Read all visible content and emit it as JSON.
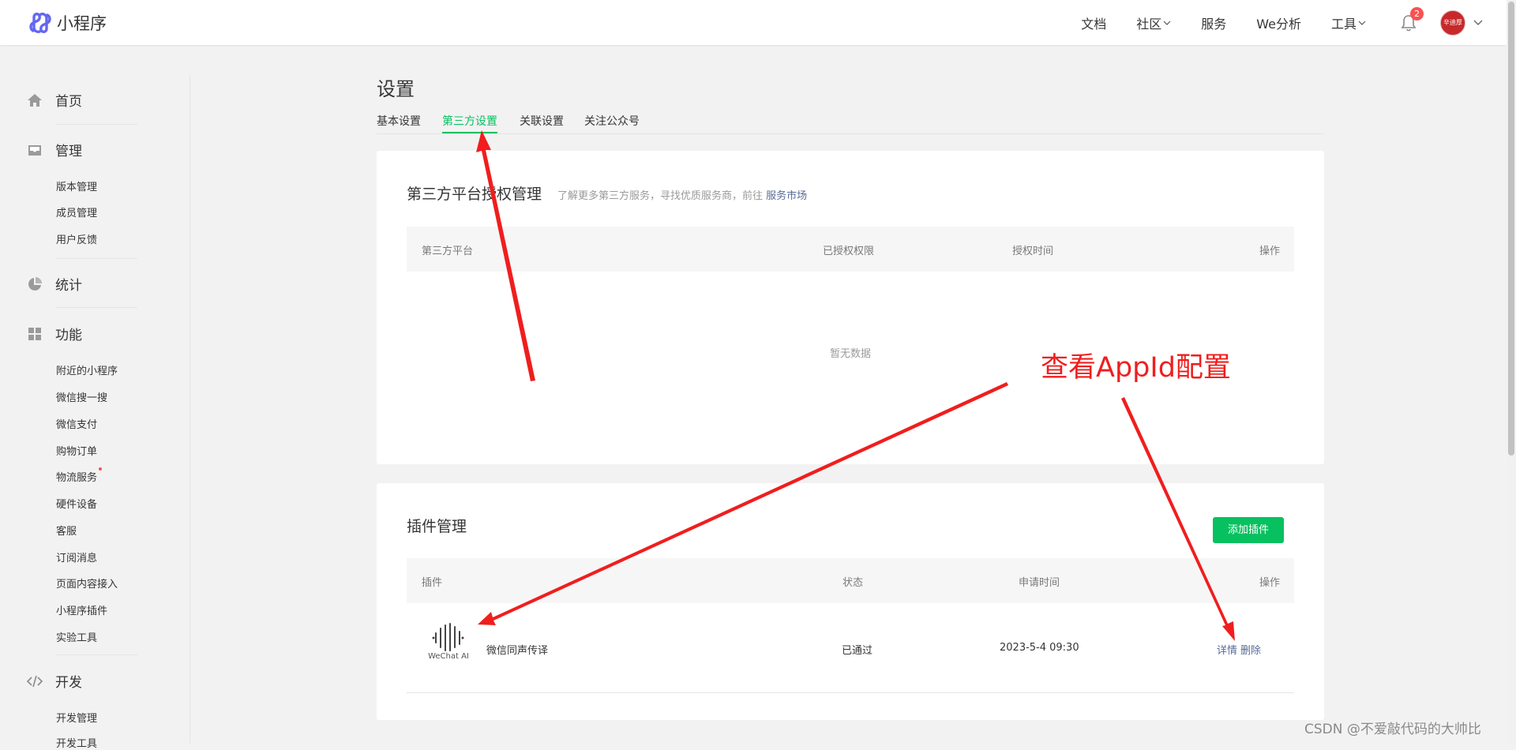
{
  "app": {
    "name": "小程序"
  },
  "topnav": {
    "items": [
      {
        "label": "文档",
        "has_dropdown": false
      },
      {
        "label": "社区",
        "has_dropdown": true
      },
      {
        "label": "服务",
        "has_dropdown": false
      },
      {
        "label": "We分析",
        "has_dropdown": false
      },
      {
        "label": "工具",
        "has_dropdown": true
      }
    ],
    "notification_count": "2",
    "avatar_text": "辛迪厚"
  },
  "sidebar": {
    "groups": [
      {
        "label": "首页",
        "icon": "home-icon",
        "items": []
      },
      {
        "label": "管理",
        "icon": "inbox-icon",
        "items": [
          "版本管理",
          "成员管理",
          "用户反馈"
        ]
      },
      {
        "label": "统计",
        "icon": "pie-chart-icon",
        "items": []
      },
      {
        "label": "功能",
        "icon": "grid-icon",
        "items": [
          "附近的小程序",
          "微信搜一搜",
          "微信支付",
          "购物订单",
          "物流服务",
          "硬件设备",
          "客服",
          "订阅消息",
          "页面内容接入",
          "小程序插件",
          "实验工具"
        ]
      },
      {
        "label": "开发",
        "icon": "code-icon",
        "items": [
          "开发管理",
          "开发工具"
        ]
      }
    ]
  },
  "page": {
    "title": "设置",
    "tabs": [
      "基本设置",
      "第三方设置",
      "关联设置",
      "关注公众号"
    ],
    "active_tab": "第三方设置"
  },
  "third_party": {
    "title": "第三方平台授权管理",
    "desc": "了解更多第三方服务，寻找优质服务商，前往",
    "desc_link": "服务市场",
    "columns": [
      "第三方平台",
      "已授权权限",
      "授权时间",
      "操作"
    ],
    "empty_text": "暂无数据"
  },
  "plugins": {
    "title": "插件管理",
    "add_button": "添加插件",
    "columns": [
      "插件",
      "状态",
      "申请时间",
      "操作"
    ],
    "rows": [
      {
        "logo_caption": "WeChat AI",
        "name": "微信同声传译",
        "status": "已通过",
        "time": "2023-5-4 09:30",
        "actions": [
          "详情",
          "删除"
        ]
      }
    ]
  },
  "annotation": {
    "text": "查看AppId配置",
    "color": "#f01e1e"
  },
  "watermark": "CSDN @不爱敲代码的大帅比",
  "colors": {
    "accent": "#07c160",
    "link": "#576b95",
    "badge": "#fa5151"
  }
}
